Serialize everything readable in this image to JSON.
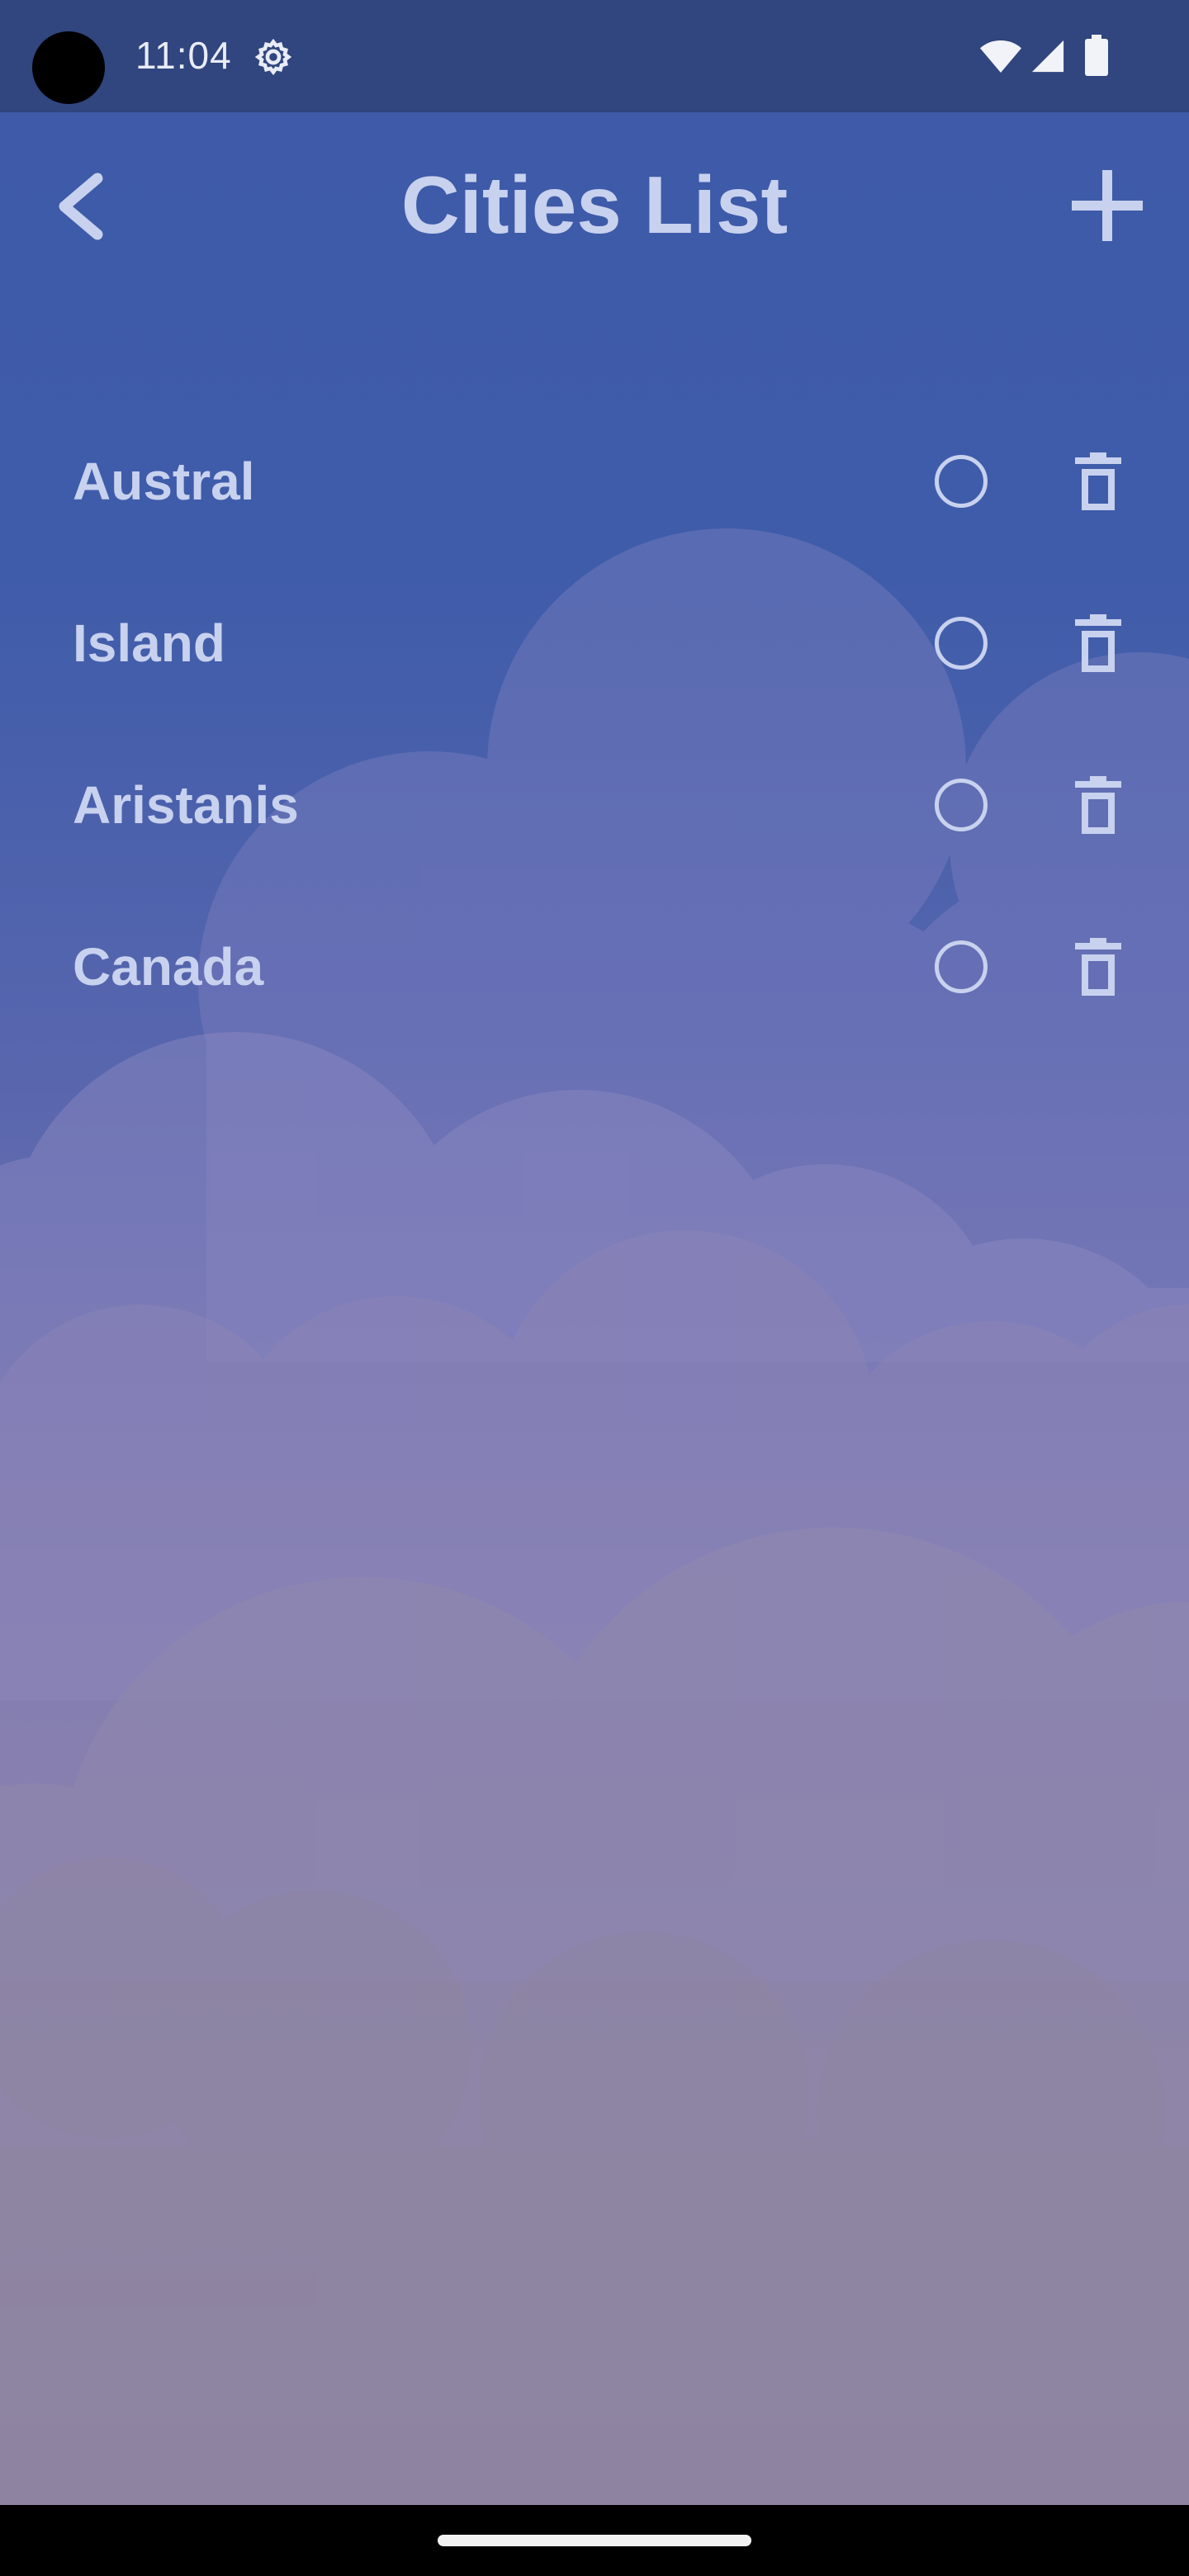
{
  "status_bar": {
    "time": "11:04",
    "icons": [
      "settings-gear-icon",
      "wifi-icon",
      "cellular-signal-icon",
      "battery-icon"
    ]
  },
  "header": {
    "title": "Cities List",
    "back_icon": "chevron-left-icon",
    "add_icon": "plus-icon"
  },
  "cities": [
    {
      "name": "Austral",
      "selected": false
    },
    {
      "name": "Island",
      "selected": false
    },
    {
      "name": "Aristanis",
      "selected": false
    },
    {
      "name": "Canada",
      "selected": false
    }
  ],
  "row_icons": {
    "select": "radio-unchecked-icon",
    "delete": "trash-icon"
  },
  "colors": {
    "status_bar": "#31457e",
    "background_top": "#3e5aa8",
    "background_bottom": "#8b7f96",
    "text": "#c8d1ee",
    "nav_bar": "#000000"
  }
}
